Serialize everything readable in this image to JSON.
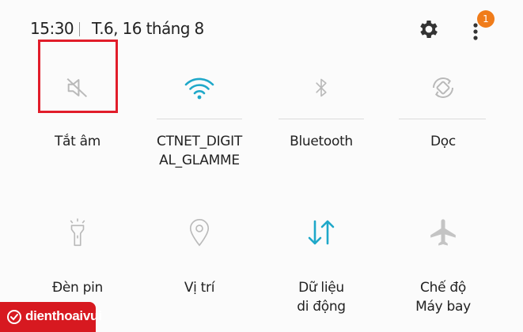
{
  "status_bar": {
    "time": "15:30",
    "date": "T.6, 16 tháng 8",
    "notification_count": "1"
  },
  "tiles": [
    {
      "label": "Tắt âm",
      "icon": "mute-icon",
      "active": false
    },
    {
      "label": "CTNET_DIGIT\nAL_GLAMME",
      "icon": "wifi-icon",
      "active": true
    },
    {
      "label": "Bluetooth",
      "icon": "bluetooth-icon",
      "active": false
    },
    {
      "label": "Dọc",
      "icon": "rotate-icon",
      "active": false
    },
    {
      "label": "Đèn pin",
      "icon": "flashlight-icon",
      "active": false
    },
    {
      "label": "Vị trí",
      "icon": "location-icon",
      "active": false
    },
    {
      "label": "Dữ liệu\ndi động",
      "icon": "mobile-data-icon",
      "active": true
    },
    {
      "label": "Chế độ\nMáy bay",
      "icon": "airplane-icon",
      "active": false
    }
  ],
  "watermark": {
    "text": "dienthoaivui"
  },
  "colors": {
    "accent": "#1fa8c9",
    "inactive": "#b9b9b9",
    "highlight": "#e11d2a",
    "badge": "#f07c1a",
    "brand": "#d71920"
  }
}
